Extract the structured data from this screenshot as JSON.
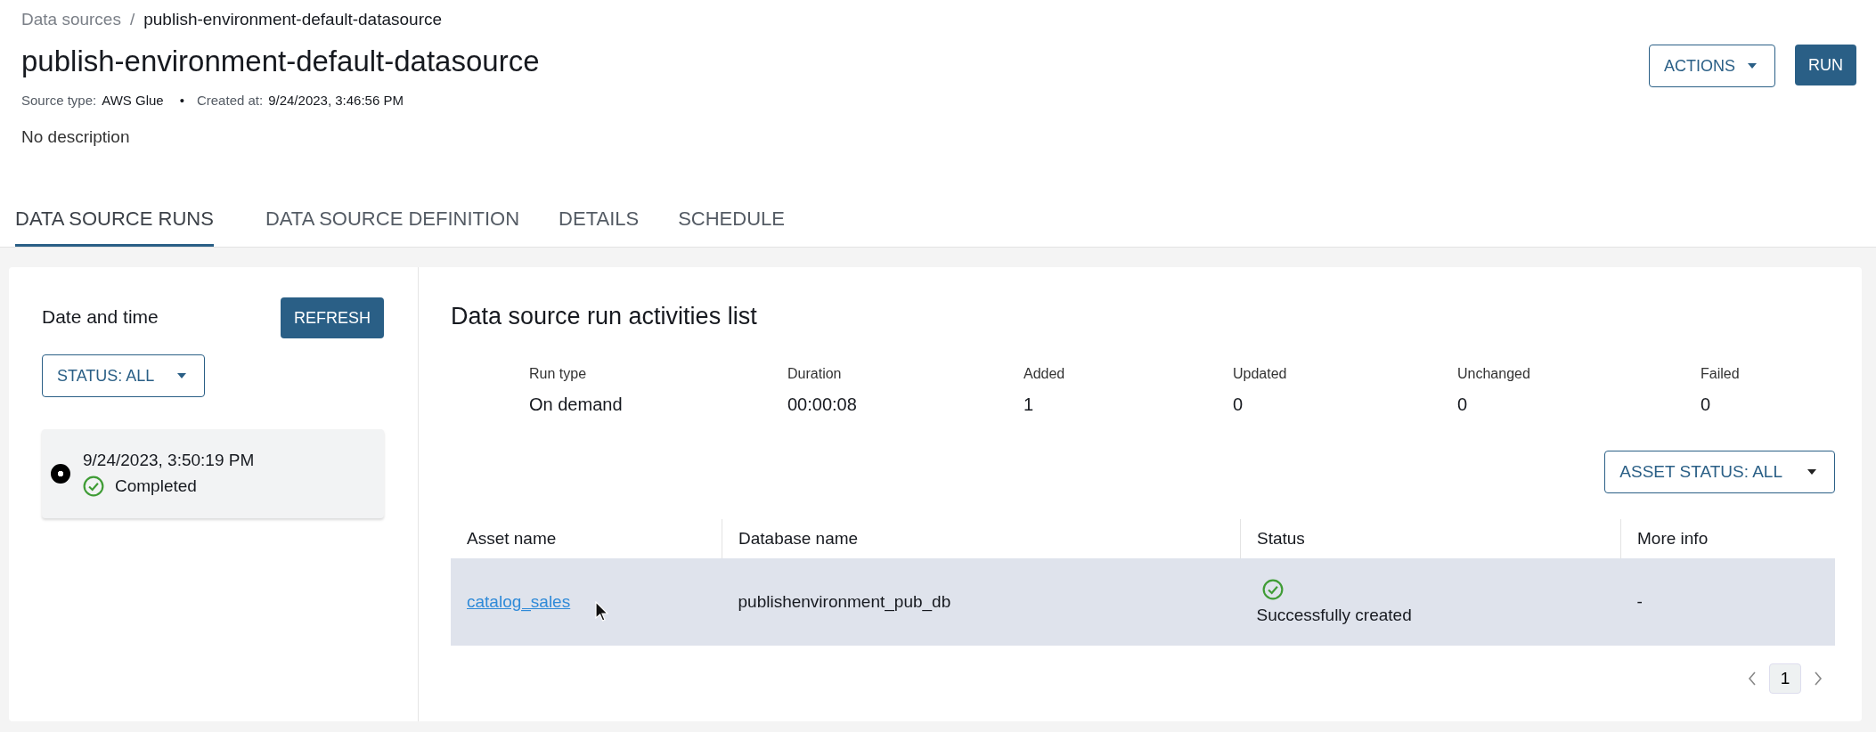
{
  "breadcrumb": {
    "parent": "Data sources",
    "separator": "/",
    "current": "publish-environment-default-datasource"
  },
  "title": "publish-environment-default-datasource",
  "meta": [
    {
      "label": "Source type:",
      "value": "AWS Glue"
    },
    {
      "label": "Created at:",
      "value": "9/24/2023, 3:46:56 PM"
    }
  ],
  "meta_separator": "•",
  "description": "No description",
  "header_buttons": [
    {
      "label": "ACTIONS",
      "kind": "dropdown"
    },
    {
      "label": "RUN",
      "kind": "primary"
    }
  ],
  "tabs": [
    {
      "label": "DATA SOURCE RUNS",
      "selected": true
    },
    {
      "label": "DATA SOURCE DEFINITION",
      "selected": false
    },
    {
      "label": "DETAILS",
      "selected": false
    },
    {
      "label": "SCHEDULE",
      "selected": false
    }
  ],
  "runs_panel": {
    "title": "Date and time",
    "refresh_button": "REFRESH",
    "filter": "STATUS: ALL",
    "runs": [
      {
        "time": "9/24/2023, 3:50:19 PM",
        "status": "Completed",
        "kind": "success",
        "selected": true
      }
    ]
  },
  "activities": {
    "title": "Data source run activities list",
    "summary": [
      {
        "label": "Run type",
        "value": "On demand"
      },
      {
        "label": "Duration",
        "value": "00:00:08"
      },
      {
        "label": "Added",
        "value": "1"
      },
      {
        "label": "Updated",
        "value": "0"
      },
      {
        "label": "Unchanged",
        "value": "0"
      },
      {
        "label": "Failed",
        "value": "0"
      }
    ],
    "filter": "ASSET STATUS: ALL",
    "table": {
      "columns": [
        "Asset name",
        "Database name",
        "Status",
        "More info"
      ],
      "rows": [
        {
          "asset_name": "catalog_sales",
          "database_name": "publishenvironment_pub_db",
          "status": "Successfully created",
          "kind": "success",
          "more_info": "-",
          "hovered": true
        }
      ]
    },
    "pagination": {
      "pages": [
        {
          "label": "1",
          "selected": true
        }
      ]
    }
  }
}
